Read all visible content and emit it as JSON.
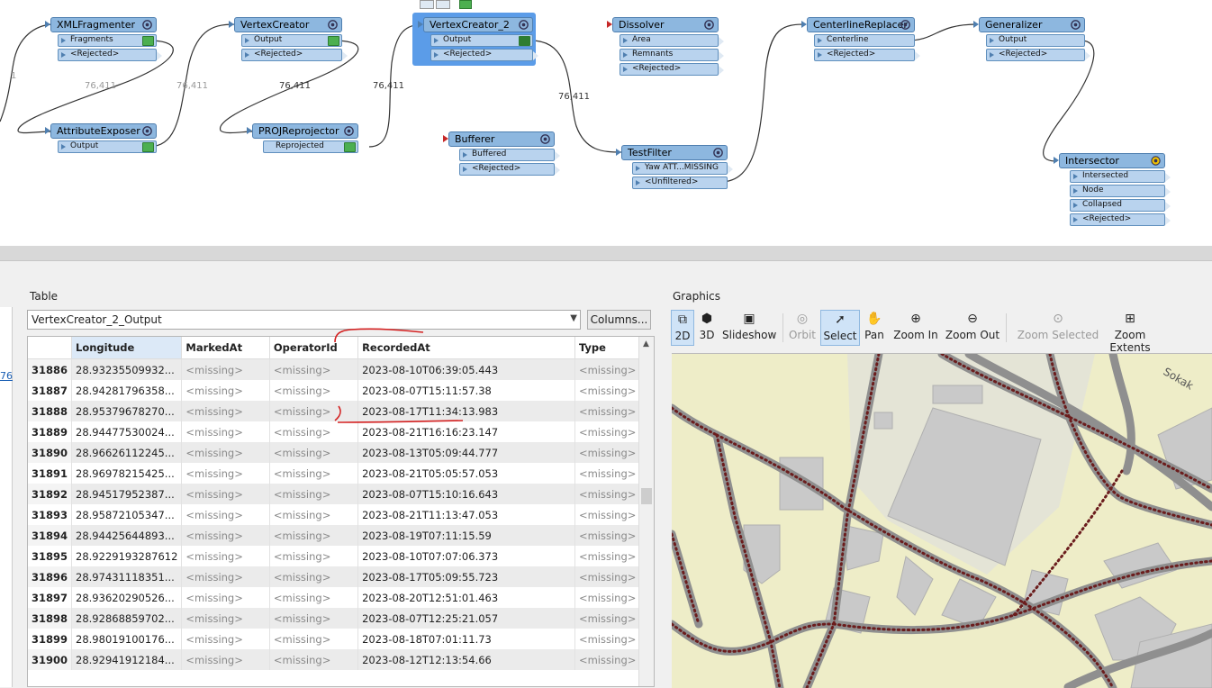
{
  "workspace": {
    "transformers": [
      {
        "id": "xmlfrag",
        "title": "XMLFragmenter",
        "ports": [
          "Fragments",
          "<Rejected>"
        ]
      },
      {
        "id": "vertex1",
        "title": "VertexCreator",
        "ports": [
          "Output",
          "<Rejected>"
        ]
      },
      {
        "id": "vertex2",
        "title": "VertexCreator_2",
        "ports": [
          "Output",
          "<Rejected>"
        ]
      },
      {
        "id": "dissolver",
        "title": "Dissolver",
        "ports": [
          "Area",
          "Remnants",
          "<Rejected>"
        ]
      },
      {
        "id": "centerline",
        "title": "CenterlineReplacer",
        "ports": [
          "Centerline",
          "<Rejected>"
        ]
      },
      {
        "id": "generalizer",
        "title": "Generalizer",
        "ports": [
          "Output",
          "<Rejected>"
        ]
      },
      {
        "id": "attrexp",
        "title": "AttributeExposer",
        "ports": [
          "Output"
        ]
      },
      {
        "id": "projrep",
        "title": "PROJReprojector",
        "ports": [
          "Reprojected"
        ]
      },
      {
        "id": "bufferer",
        "title": "Bufferer",
        "ports": [
          "Buffered",
          "<Rejected>"
        ]
      },
      {
        "id": "testfilter",
        "title": "TestFilter",
        "ports": [
          "Yaw ATT...MISSING",
          "<Unfiltered>"
        ]
      },
      {
        "id": "intersector",
        "title": "Intersector",
        "ports": [
          "Intersected",
          "Node",
          "Collapsed",
          "<Rejected>"
        ]
      }
    ],
    "wire_labels": {
      "a": "76,411",
      "b": "76,411",
      "c": "76,411",
      "d": "76,411",
      "e": "76,411",
      "f": "1"
    }
  },
  "left_link": "76",
  "table": {
    "pane_title": "Table",
    "selected_dataset": "VertexCreator_2_Output",
    "columns_button": "Columns...",
    "headers": [
      "Longitude",
      "MarkedAt",
      "OperatorId",
      "RecordedAt",
      "Type"
    ],
    "rows": [
      {
        "n": "31886",
        "lon": "28.93235509932...",
        "m": "<missing>",
        "o": "<missing>",
        "r": "2023-08-10T06:39:05.443",
        "t": "<missing>"
      },
      {
        "n": "31887",
        "lon": "28.94281796358...",
        "m": "<missing>",
        "o": "<missing>",
        "r": "2023-08-07T15:11:57.38",
        "t": "<missing>"
      },
      {
        "n": "31888",
        "lon": "28.95379678270...",
        "m": "<missing>",
        "o": "<missing>",
        "r": "2023-08-17T11:34:13.983",
        "t": "<missing>"
      },
      {
        "n": "31889",
        "lon": "28.94477530024...",
        "m": "<missing>",
        "o": "<missing>",
        "r": "2023-08-21T16:16:23.147",
        "t": "<missing>"
      },
      {
        "n": "31890",
        "lon": "28.96626112245...",
        "m": "<missing>",
        "o": "<missing>",
        "r": "2023-08-13T05:09:44.777",
        "t": "<missing>"
      },
      {
        "n": "31891",
        "lon": "28.96978215425...",
        "m": "<missing>",
        "o": "<missing>",
        "r": "2023-08-21T05:05:57.053",
        "t": "<missing>"
      },
      {
        "n": "31892",
        "lon": "28.94517952387...",
        "m": "<missing>",
        "o": "<missing>",
        "r": "2023-08-07T15:10:16.643",
        "t": "<missing>"
      },
      {
        "n": "31893",
        "lon": "28.95872105347...",
        "m": "<missing>",
        "o": "<missing>",
        "r": "2023-08-21T11:13:47.053",
        "t": "<missing>"
      },
      {
        "n": "31894",
        "lon": "28.94425644893...",
        "m": "<missing>",
        "o": "<missing>",
        "r": "2023-08-19T07:11:15.59",
        "t": "<missing>"
      },
      {
        "n": "31895",
        "lon": "28.9229193287612",
        "m": "<missing>",
        "o": "<missing>",
        "r": "2023-08-10T07:07:06.373",
        "t": "<missing>"
      },
      {
        "n": "31896",
        "lon": "28.97431118351...",
        "m": "<missing>",
        "o": "<missing>",
        "r": "2023-08-17T05:09:55.723",
        "t": "<missing>"
      },
      {
        "n": "31897",
        "lon": "28.93620290526...",
        "m": "<missing>",
        "o": "<missing>",
        "r": "2023-08-20T12:51:01.463",
        "t": "<missing>"
      },
      {
        "n": "31898",
        "lon": "28.92868859702...",
        "m": "<missing>",
        "o": "<missing>",
        "r": "2023-08-07T12:25:21.057",
        "t": "<missing>"
      },
      {
        "n": "31899",
        "lon": "28.98019100176...",
        "m": "<missing>",
        "o": "<missing>",
        "r": "2023-08-18T07:01:11.73",
        "t": "<missing>"
      },
      {
        "n": "31900",
        "lon": "28.92941912184...",
        "m": "<missing>",
        "o": "<missing>",
        "r": "2023-08-12T12:13:54.66",
        "t": "<missing>"
      }
    ]
  },
  "graphics": {
    "pane_title": "Graphics",
    "toolbar": [
      {
        "label": "2D",
        "icon": "view-2d-icon",
        "enabled": true,
        "active": true
      },
      {
        "label": "3D",
        "icon": "view-3d-icon",
        "enabled": true,
        "active": false
      },
      {
        "label": "Slideshow",
        "icon": "slideshow-icon",
        "enabled": true,
        "active": false
      },
      {
        "label": "Orbit",
        "icon": "orbit-icon",
        "enabled": false,
        "active": false
      },
      {
        "label": "Select",
        "icon": "select-cursor-icon",
        "enabled": true,
        "active": true
      },
      {
        "label": "Pan",
        "icon": "hand-pan-icon",
        "enabled": true,
        "active": false
      },
      {
        "label": "Zoom In",
        "icon": "zoom-in-icon",
        "enabled": true,
        "active": false
      },
      {
        "label": "Zoom Out",
        "icon": "zoom-out-icon",
        "enabled": true,
        "active": false
      },
      {
        "label": "Zoom Selected",
        "icon": "zoom-selected-icon",
        "enabled": false,
        "active": false
      },
      {
        "label": "Zoom Extents",
        "icon": "zoom-extents-icon",
        "enabled": true,
        "active": false
      }
    ],
    "map_label": "Sokak",
    "colors": {
      "map_bg": "#eeedc8",
      "road": "#8f8f8f",
      "building": "#c9c9c9",
      "vertex": "#6b1d1d",
      "selected": "#5b9ce8"
    }
  }
}
